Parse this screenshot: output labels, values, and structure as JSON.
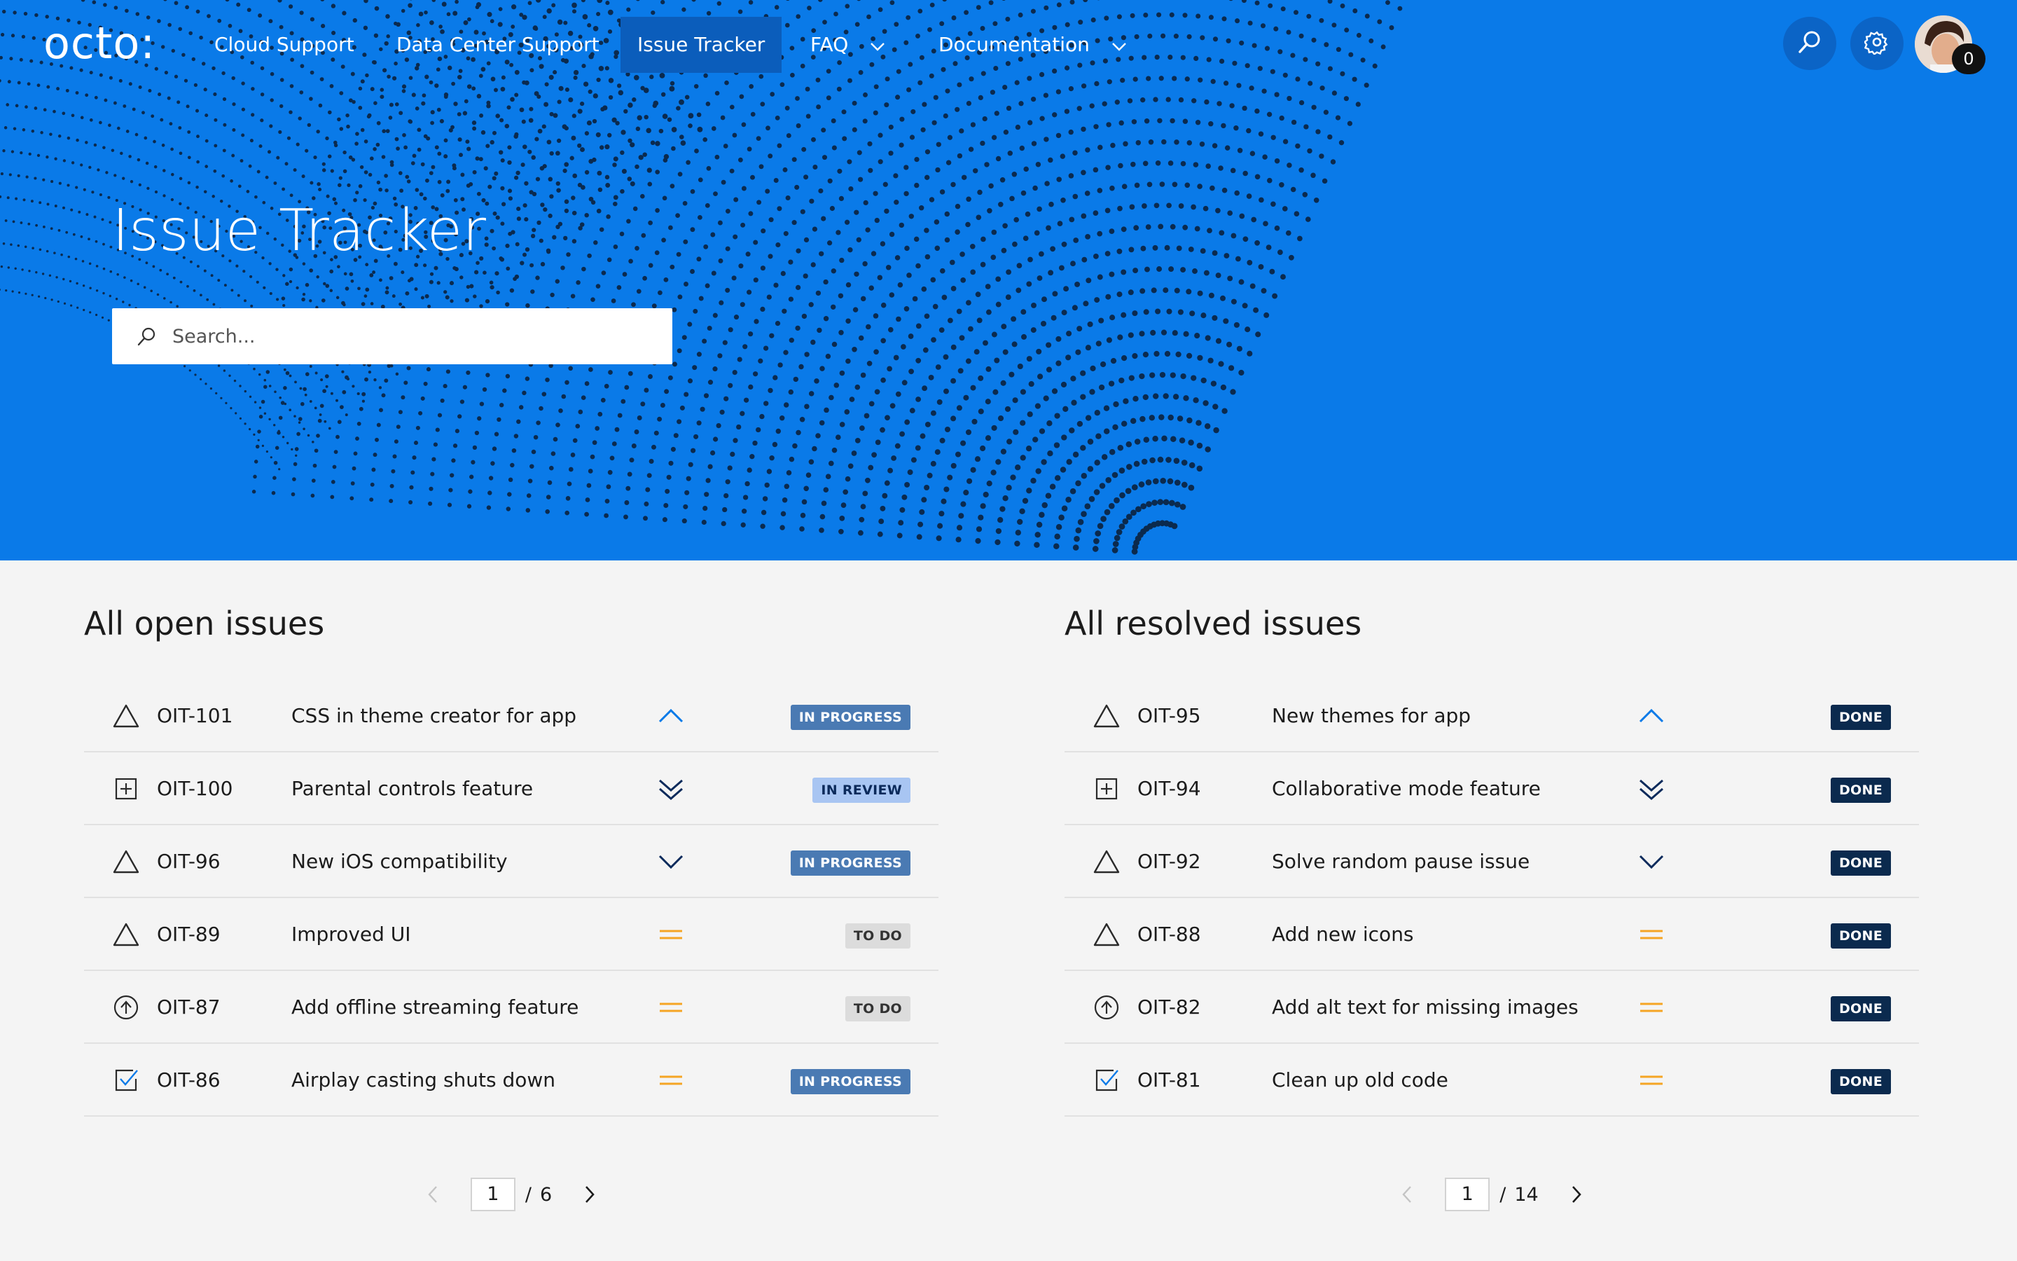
{
  "nav": {
    "logo": "octo:",
    "items": [
      {
        "label": "Cloud Support",
        "active": false
      },
      {
        "label": "Data Center Support",
        "active": false
      },
      {
        "label": "Issue Tracker",
        "active": true
      },
      {
        "label": "FAQ",
        "active": false,
        "dropdown": true
      },
      {
        "label": "Documentation",
        "active": false,
        "dropdown": true
      }
    ],
    "notification_count": "0"
  },
  "hero": {
    "title": "Issue Tracker",
    "search_placeholder": "Search..."
  },
  "colors": {
    "hero_bg": "#0a7ae8",
    "nav_active": "#0b5dbb",
    "prio_high": "#0a7ae8",
    "prio_medium": "#f5a524",
    "prio_low": "#0b2a5b",
    "status_in_progress_bg": "#4a7ab3",
    "status_in_review_bg": "#a8c5f2",
    "status_todo_bg": "#dcdcdc",
    "status_done_bg": "#0b2a4e"
  },
  "open_issues": {
    "title": "All open issues",
    "items": [
      {
        "type": "bug-icon",
        "key": "OIT-101",
        "title": "CSS in theme creator for app",
        "priority": "high",
        "status": "IN PROGRESS"
      },
      {
        "type": "new-feature-icon",
        "key": "OIT-100",
        "title": "Parental controls feature",
        "priority": "lowest",
        "status": "IN REVIEW"
      },
      {
        "type": "bug-icon",
        "key": "OIT-96",
        "title": "New iOS compatibility",
        "priority": "low",
        "status": "IN PROGRESS"
      },
      {
        "type": "bug-icon",
        "key": "OIT-89",
        "title": "Improved UI",
        "priority": "medium",
        "status": "TO DO"
      },
      {
        "type": "improvement-icon",
        "key": "OIT-87",
        "title": "Add offline streaming feature",
        "priority": "medium",
        "status": "TO DO"
      },
      {
        "type": "task-icon",
        "key": "OIT-86",
        "title": "Airplay casting shuts down",
        "priority": "medium",
        "status": "IN PROGRESS"
      }
    ],
    "pagination": {
      "current": "1",
      "separator": "/",
      "total": "6"
    }
  },
  "resolved_issues": {
    "title": "All resolved issues",
    "items": [
      {
        "type": "bug-icon",
        "key": "OIT-95",
        "title": "New themes for app",
        "priority": "high",
        "status": "DONE"
      },
      {
        "type": "new-feature-icon",
        "key": "OIT-94",
        "title": "Collaborative mode feature",
        "priority": "lowest",
        "status": "DONE"
      },
      {
        "type": "bug-icon",
        "key": "OIT-92",
        "title": "Solve random pause issue",
        "priority": "low",
        "status": "DONE"
      },
      {
        "type": "bug-icon",
        "key": "OIT-88",
        "title": "Add new icons",
        "priority": "medium",
        "status": "DONE"
      },
      {
        "type": "improvement-icon",
        "key": "OIT-82",
        "title": "Add alt text for missing images",
        "priority": "medium",
        "status": "DONE"
      },
      {
        "type": "task-icon",
        "key": "OIT-81",
        "title": "Clean up old code",
        "priority": "medium",
        "status": "DONE"
      }
    ],
    "pagination": {
      "current": "1",
      "separator": "/",
      "total": "14"
    }
  }
}
